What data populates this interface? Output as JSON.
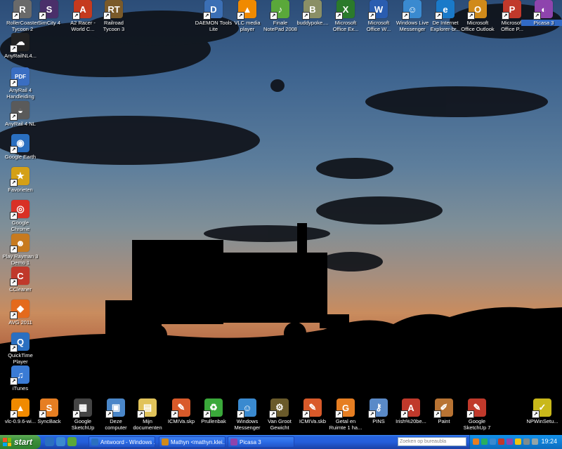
{
  "desktop": {
    "icons": [
      {
        "label": "RollerCoaster\nTycoon 2",
        "sym": "R",
        "color": "#6a6a6a"
      },
      {
        "label": "SimCity 4",
        "sym": "S",
        "color": "#4a2f6a"
      },
      {
        "label": "A2 Racer -\nWorld C...",
        "sym": "A",
        "color": "#c53a1e"
      },
      {
        "label": "Railroad\nTycoon 3",
        "sym": "RT",
        "color": "#7a5a2a"
      },
      {
        "label": "DAEMON Tools\nLite",
        "sym": "D",
        "color": "#3b6fb5"
      },
      {
        "label": "VLC media\nplayer",
        "sym": "▲",
        "color": "#f08a00"
      },
      {
        "label": "Finale\nNotePad 2008",
        "sym": "♪",
        "color": "#5aa83a"
      },
      {
        "label": "buddypoke....",
        "sym": "B",
        "color": "#8a8f66"
      },
      {
        "label": "Microsoft\nOffice Ex...",
        "sym": "X",
        "color": "#2b7a2b"
      },
      {
        "label": "Microsoft\nOffice W...",
        "sym": "W",
        "color": "#2a5db0"
      },
      {
        "label": "Windows Live\nMessenger",
        "sym": "☺",
        "color": "#3a8ad0"
      },
      {
        "label": "De Internet\nExplorer-br...",
        "sym": "e",
        "color": "#1a7ac9"
      },
      {
        "label": "Microsoft\nOffice Outlook",
        "sym": "O",
        "color": "#d08a1a"
      },
      {
        "label": "Microsoft\nOffice P...",
        "sym": "P",
        "color": "#c0392b"
      },
      {
        "label": "Picasa 3",
        "sym": "◐",
        "color": "#8e44ad"
      },
      {
        "label": "AnyRailNL4...",
        "sym": "☁",
        "color": "#222222"
      },
      {
        "label": "AnyRail 4\nHandleiding",
        "sym": "PDF",
        "color": "#3a6ec2"
      },
      {
        "label": "AnyRail 4 NL",
        "sym": "◒",
        "color": "#5a5a5a"
      },
      {
        "label": "Google Earth",
        "sym": "◉",
        "color": "#2a6fc0"
      },
      {
        "label": "Favorieten",
        "sym": "★",
        "color": "#d4a017"
      },
      {
        "label": "Google\nChrome",
        "sym": "◎",
        "color": "#d93025"
      },
      {
        "label": "Play Rayman 3\nDemo 1",
        "sym": "☻",
        "color": "#c77a1f"
      },
      {
        "label": "CCleaner",
        "sym": "C",
        "color": "#c0392b"
      },
      {
        "label": "AVG 2011",
        "sym": "◆",
        "color": "#e46a1c"
      },
      {
        "label": "QuickTime\nPlayer",
        "sym": "Q",
        "color": "#2a6fc0"
      },
      {
        "label": "iTunes",
        "sym": "♫",
        "color": "#3a7bd5"
      },
      {
        "label": "vlc-0.9.6-wi...",
        "sym": "▲",
        "color": "#f08a00"
      },
      {
        "label": "SyncBack",
        "sym": "S",
        "color": "#e67e22"
      },
      {
        "label": "Google\nSketchUp",
        "sym": "▦",
        "color": "#444444"
      },
      {
        "label": "Deze\ncomputer",
        "sym": "▣",
        "color": "#4a86c8"
      },
      {
        "label": "Mijn\ndocumenten",
        "sym": "▤",
        "color": "#e1c35a"
      },
      {
        "label": "ICMIVa.skp",
        "sym": "✎",
        "color": "#d95a2a"
      },
      {
        "label": "Prullenbak",
        "sym": "♻",
        "color": "#3aa83a"
      },
      {
        "label": "Windows\nMessenger",
        "sym": "☺",
        "color": "#3a8ad0"
      },
      {
        "label": "Van Groot\nGewicht",
        "sym": "⚙",
        "color": "#6a5a2a"
      },
      {
        "label": "ICMIVa.skb",
        "sym": "✎",
        "color": "#d95a2a"
      },
      {
        "label": "Getal en\nRuimte 1 ha...",
        "sym": "G",
        "color": "#e67e22"
      },
      {
        "label": "PINS",
        "sym": "⚷",
        "color": "#5a8ac8"
      },
      {
        "label": "Irish%20be...",
        "sym": "A",
        "color": "#c0392b"
      },
      {
        "label": "Paint",
        "sym": "✐",
        "color": "#b87333"
      },
      {
        "label": "Google\nSketchUp 7",
        "sym": "✎",
        "color": "#c0392b"
      },
      {
        "label": "NPWinSetu...",
        "sym": "✓",
        "color": "#c9b81a"
      }
    ]
  },
  "taskbar": {
    "start_label": "start",
    "tasks": [
      {
        "label": "Antwoord - Windows ...",
        "color": "#2a6fc0"
      },
      {
        "label": "Mathyn <mathyn.klei...",
        "color": "#d08a1a"
      },
      {
        "label": "Picasa 3",
        "color": "#8e44ad"
      }
    ],
    "search_placeholder": "Zoeken op bureaubla",
    "clock": "19:24"
  }
}
